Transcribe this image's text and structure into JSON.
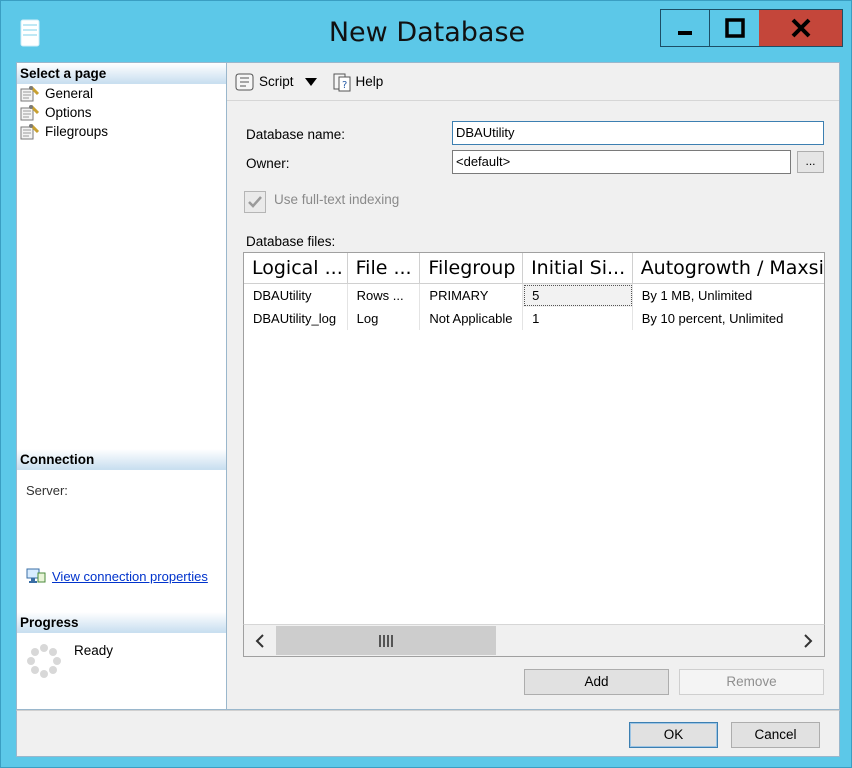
{
  "window": {
    "title": "New Database",
    "icon": "database-icon",
    "controls": [
      "minimize-icon",
      "maximize-icon",
      "close-icon"
    ]
  },
  "left_pane": {
    "select_page_header": "Select a page",
    "pages": [
      {
        "label": "General",
        "icon": "page-wrench-icon",
        "selected": true
      },
      {
        "label": "Options",
        "icon": "page-wrench-icon",
        "selected": false
      },
      {
        "label": "Filegroups",
        "icon": "page-wrench-icon",
        "selected": false
      }
    ],
    "connection_header": "Connection",
    "server_label": "Server:",
    "view_connection_link": "View connection properties",
    "progress_header": "Progress",
    "progress_status": "Ready"
  },
  "toolbar": {
    "script_label": "Script",
    "help_label": "Help"
  },
  "form": {
    "database_name_label": "Database name:",
    "database_name_value": "DBAUtility",
    "owner_label": "Owner:",
    "owner_value": "<default>",
    "browse_label": "...",
    "fulltext_label": "Use full-text indexing",
    "fulltext_checked": true,
    "database_files_label": "Database files:"
  },
  "grid": {
    "columns": [
      "Logical ...",
      "File ...",
      "Filegroup",
      "Initial Si...",
      "Autogrowth / Maxsiz"
    ],
    "rows": [
      [
        "DBAUtility",
        "Rows ...",
        "PRIMARY",
        "5",
        "By 1 MB, Unlimited"
      ],
      [
        "DBAUtility_log",
        "Log",
        "Not Applicable",
        "1",
        "By 10 percent, Unlimited"
      ]
    ]
  },
  "buttons": {
    "add": "Add",
    "remove": "Remove",
    "ok": "OK",
    "cancel": "Cancel"
  },
  "colors": {
    "window_frame": "#5cc8e8",
    "close_button": "#c4463a",
    "pane_header": "#c9dff0",
    "link": "#0033cc"
  }
}
